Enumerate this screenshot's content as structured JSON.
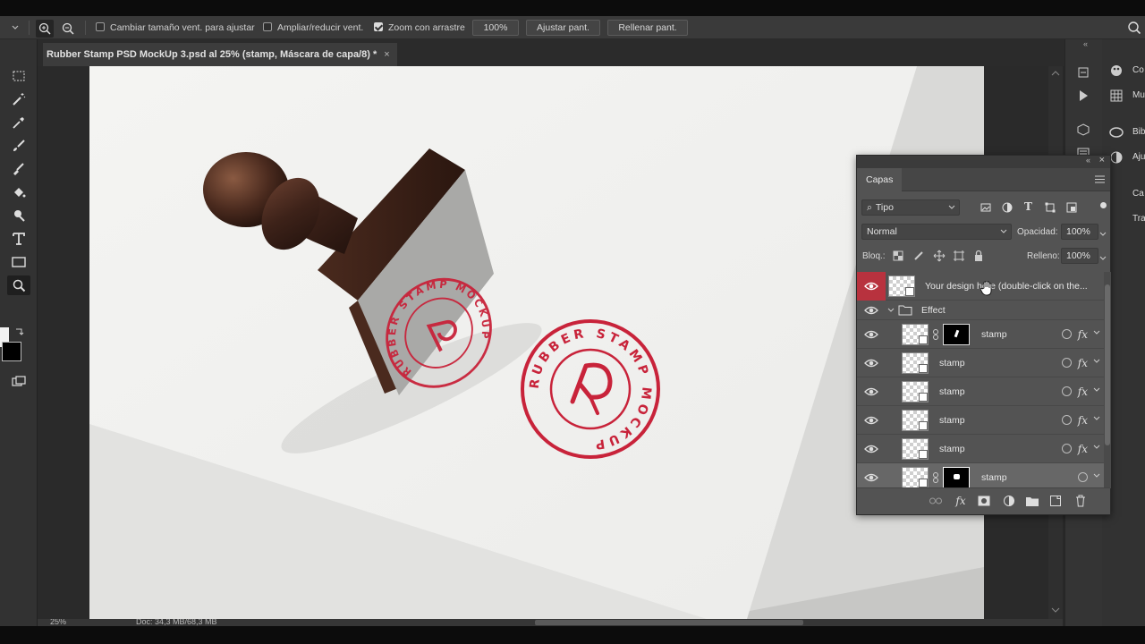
{
  "options_bar": {
    "resize_windows_label": "Cambiar tamaño vent. para ajustar",
    "zoom_all_windows_label": "Ampliar/reducir vent.",
    "scrubby_zoom_label": "Zoom con arrastre",
    "zoom_value": "100%",
    "fit_screen_label": "Ajustar pant.",
    "fill_screen_label": "Rellenar pant."
  },
  "document": {
    "tab_title": "Rubber Stamp PSD MockUp 3.psd al 25% (stamp, Máscara de capa/8) *",
    "close_glyph": "×"
  },
  "status": {
    "zoom": "25%",
    "doc_size": "Doc: 34,3 MB/68,3 MB"
  },
  "right_dock": {
    "items": [
      {
        "icon": "color-icon",
        "label": "Co"
      },
      {
        "icon": "grid-icon",
        "label": "Mu"
      },
      {
        "icon": "libraries-icon",
        "label": "Bib"
      },
      {
        "icon": "adjustments-icon",
        "label": "Aju"
      },
      {
        "icon": "channels-icon",
        "label": "Ca"
      },
      {
        "icon": "paths-icon",
        "label": "Tra"
      }
    ]
  },
  "layers_panel": {
    "tab_label": "Capas",
    "filter_label": "Tipo",
    "blend_mode": "Normal",
    "opacity_label": "Opacidad:",
    "opacity_value": "100%",
    "lock_label": "Bloq.:",
    "fill_label": "Relleno:",
    "fill_value": "100%",
    "layers": [
      {
        "name": "Your design here (double-click on the...",
        "type": "smart",
        "selected": false,
        "highlight_eye": true
      },
      {
        "name": "Effect",
        "type": "group"
      },
      {
        "name": "stamp",
        "type": "smart-mask",
        "fx": true
      },
      {
        "name": "stamp",
        "type": "smart",
        "fx": true
      },
      {
        "name": "stamp",
        "type": "smart",
        "fx": true
      },
      {
        "name": "stamp",
        "type": "smart",
        "fx": true
      },
      {
        "name": "stamp",
        "type": "smart",
        "fx": true
      },
      {
        "name": "stamp",
        "type": "smart-mask",
        "fx": false,
        "selected": true
      }
    ]
  },
  "artwork": {
    "stamp_ring_text": "RUBBER STAMP MOCKUP",
    "stamp_color": "#c8233a"
  },
  "colors": {
    "panel_bg": "#535353",
    "accent_red": "#b8323e"
  }
}
